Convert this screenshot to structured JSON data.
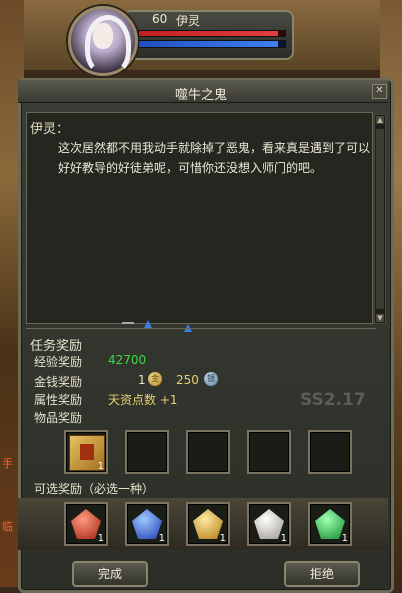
{
  "npc": {
    "level": "60",
    "name": "伊灵",
    "hp_fraction": 0.95,
    "mp_fraction": 0.95
  },
  "window": {
    "title": "噬牛之鬼",
    "close_label": "✕"
  },
  "dialog": {
    "speaker": "伊灵：",
    "text": "这次居然都不用我动手就除掉了恶鬼，看来真是遇到了可以好好教导的好徒弟呢，可惜你还没想入师门的吧。"
  },
  "rewards": {
    "section_label": "任务奖励",
    "exp_label": "经验奖励",
    "exp_value": "42700",
    "money_label": "金钱奖励",
    "gold_amount": "1",
    "gold_icon": "金",
    "bound_amount": "250",
    "bound_icon": "银",
    "attr_label": "属性奖励",
    "attr_value": "天资点数 +1",
    "item_label": "物品奖励",
    "item_slots": [
      {
        "icon": "scroll-icon",
        "count": "1"
      },
      {
        "icon": "",
        "count": ""
      },
      {
        "icon": "",
        "count": ""
      },
      {
        "icon": "",
        "count": ""
      },
      {
        "icon": "",
        "count": ""
      }
    ],
    "optional_label": "可选奖励（必选一种）",
    "optional_slots": [
      {
        "icon": "red-gem-icon",
        "count": "1"
      },
      {
        "icon": "blue-gem-icon",
        "count": "1"
      },
      {
        "icon": "gold-gem-icon",
        "count": "1"
      },
      {
        "icon": "white-gem-icon",
        "count": "1"
      },
      {
        "icon": "green-gem-icon",
        "count": "1"
      }
    ]
  },
  "buttons": {
    "complete": "完成",
    "refuse": "拒绝"
  },
  "watermark": "SS2.17",
  "side_text": [
    "手",
    "临"
  ],
  "colors": {
    "exp_value": "#3cd846",
    "attr_value": "#e8d070",
    "marker": "#3a80e0"
  }
}
